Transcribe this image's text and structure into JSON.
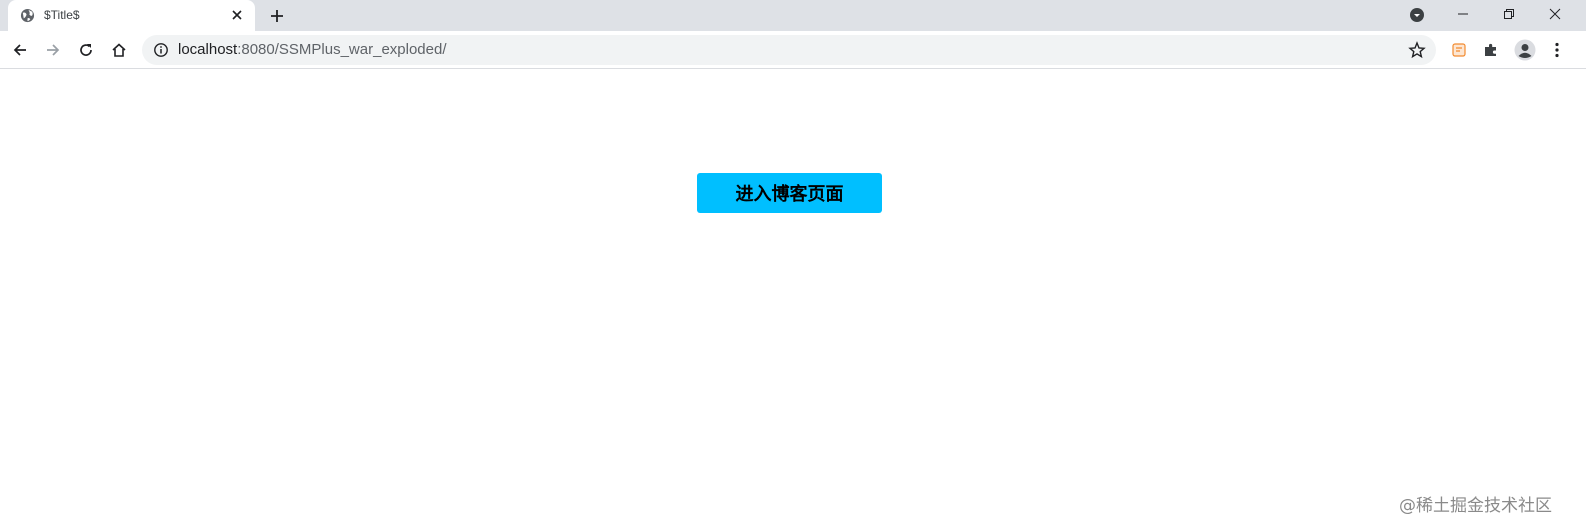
{
  "browser": {
    "tab": {
      "title": "$Title$"
    },
    "address_bar": {
      "host": "localhost",
      "path": ":8080/SSMPlus_war_exploded/"
    },
    "icons": {
      "favicon": "globe-icon",
      "close": "close-icon",
      "new_tab": "plus-icon",
      "tab_search": "tab-search-icon",
      "back": "back-arrow-icon",
      "forward": "forward-arrow-icon",
      "reload": "reload-icon",
      "home": "home-icon",
      "site_info": "info-icon",
      "bookmark": "star-icon",
      "extension": "extension-icon",
      "extensions_menu": "puzzle-icon",
      "profile": "profile-icon",
      "menu": "kebab-menu-icon"
    }
  },
  "page": {
    "enter_button_label": "进入博客页面",
    "watermark": "@稀土掘金技术社区"
  },
  "colors": {
    "button_bg": "#00bfff",
    "tabstrip_bg": "#dee1e6",
    "omnibox_bg": "#f1f3f4"
  }
}
